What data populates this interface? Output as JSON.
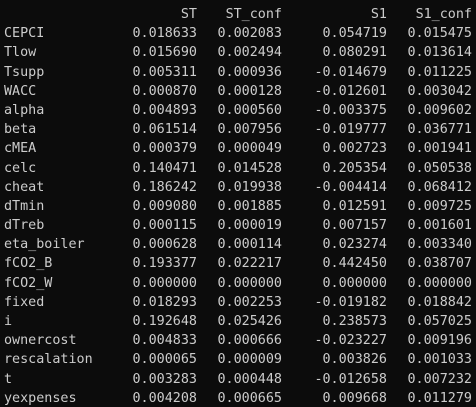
{
  "columns": {
    "label": "",
    "st": "ST",
    "st_conf": "ST_conf",
    "s1": "S1",
    "s1_conf": "S1_conf"
  },
  "rows": [
    {
      "label": "CEPCI",
      "st": "0.018633",
      "st_conf": "0.002083",
      "s1": "0.054719",
      "s1_conf": "0.015475"
    },
    {
      "label": "Tlow",
      "st": "0.015690",
      "st_conf": "0.002494",
      "s1": "0.080291",
      "s1_conf": "0.013614"
    },
    {
      "label": "Tsupp",
      "st": "0.005311",
      "st_conf": "0.000936",
      "s1": "-0.014679",
      "s1_conf": "0.011225"
    },
    {
      "label": "WACC",
      "st": "0.000870",
      "st_conf": "0.000128",
      "s1": "-0.012601",
      "s1_conf": "0.003042"
    },
    {
      "label": "alpha",
      "st": "0.004893",
      "st_conf": "0.000560",
      "s1": "-0.003375",
      "s1_conf": "0.009602"
    },
    {
      "label": "beta",
      "st": "0.061514",
      "st_conf": "0.007956",
      "s1": "-0.019777",
      "s1_conf": "0.036771"
    },
    {
      "label": "cMEA",
      "st": "0.000379",
      "st_conf": "0.000049",
      "s1": "0.002723",
      "s1_conf": "0.001941"
    },
    {
      "label": "celc",
      "st": "0.140471",
      "st_conf": "0.014528",
      "s1": "0.205354",
      "s1_conf": "0.050538"
    },
    {
      "label": "cheat",
      "st": "0.186242",
      "st_conf": "0.019938",
      "s1": "-0.004414",
      "s1_conf": "0.068412"
    },
    {
      "label": "dTmin",
      "st": "0.009080",
      "st_conf": "0.001885",
      "s1": "0.012591",
      "s1_conf": "0.009725"
    },
    {
      "label": "dTreb",
      "st": "0.000115",
      "st_conf": "0.000019",
      "s1": "0.007157",
      "s1_conf": "0.001601"
    },
    {
      "label": "eta_boiler",
      "st": "0.000628",
      "st_conf": "0.000114",
      "s1": "0.023274",
      "s1_conf": "0.003340"
    },
    {
      "label": "fCO2_B",
      "st": "0.193377",
      "st_conf": "0.022217",
      "s1": "0.442450",
      "s1_conf": "0.038707"
    },
    {
      "label": "fCO2_W",
      "st": "0.000000",
      "st_conf": "0.000000",
      "s1": "0.000000",
      "s1_conf": "0.000000"
    },
    {
      "label": "fixed",
      "st": "0.018293",
      "st_conf": "0.002253",
      "s1": "-0.019182",
      "s1_conf": "0.018842"
    },
    {
      "label": "i",
      "st": "0.192648",
      "st_conf": "0.025426",
      "s1": "0.238573",
      "s1_conf": "0.057025"
    },
    {
      "label": "ownercost",
      "st": "0.004833",
      "st_conf": "0.000666",
      "s1": "-0.023227",
      "s1_conf": "0.009196"
    },
    {
      "label": "rescalation",
      "st": "0.000065",
      "st_conf": "0.000009",
      "s1": "0.003826",
      "s1_conf": "0.001033"
    },
    {
      "label": "t",
      "st": "0.003283",
      "st_conf": "0.000448",
      "s1": "-0.012658",
      "s1_conf": "0.007232"
    },
    {
      "label": "yexpenses",
      "st": "0.004208",
      "st_conf": "0.000665",
      "s1": "0.009668",
      "s1_conf": "0.011279"
    }
  ]
}
